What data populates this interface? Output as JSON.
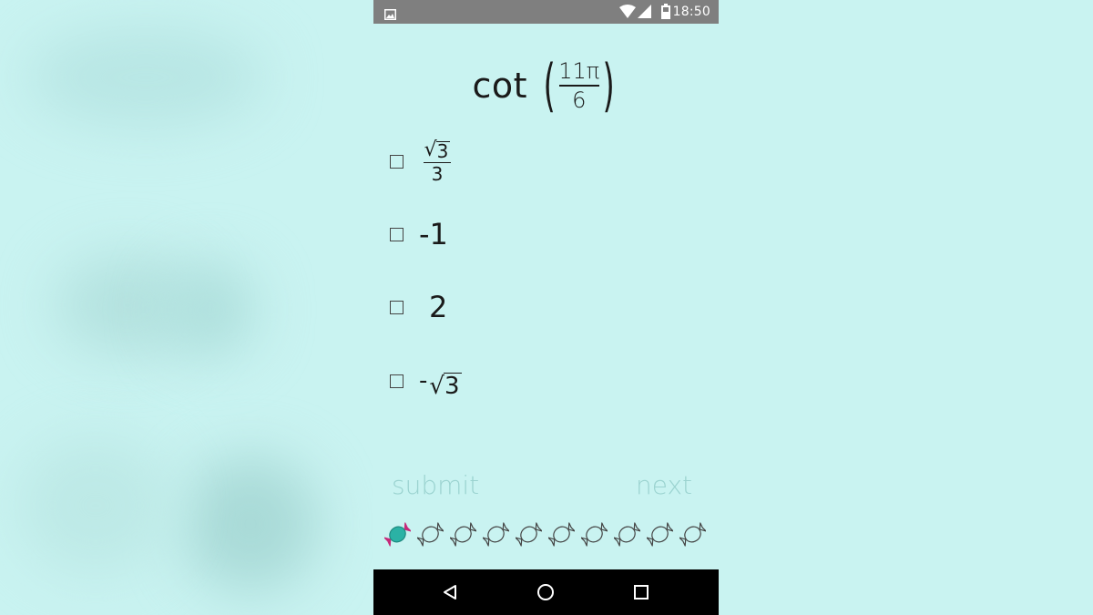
{
  "status_bar": {
    "time": "18:50",
    "icons": [
      "image-notification-icon",
      "wifi-icon",
      "cell-signal-icon",
      "battery-icon"
    ]
  },
  "question": {
    "function": "cot",
    "numerator": "11π",
    "denominator": "6"
  },
  "options": [
    {
      "sqrt_arg": "3",
      "denominator": "3"
    },
    {
      "text": "-1"
    },
    {
      "text": "2"
    },
    {
      "prefix": "-",
      "sqrt_arg": "3"
    }
  ],
  "actions": {
    "submit_label": "submit",
    "next_label": "next"
  },
  "progress": {
    "total": 10,
    "completed": 1
  },
  "nav_bar": {
    "buttons": [
      "back-icon",
      "home-icon",
      "recents-icon"
    ]
  },
  "colors": {
    "background": "#c9f3f1",
    "disabled_text": "#9bd3d0",
    "candy_active_body": "#2bb2a5",
    "candy_active_wrapper": "#c72a7a",
    "candy_outline": "#444444"
  }
}
